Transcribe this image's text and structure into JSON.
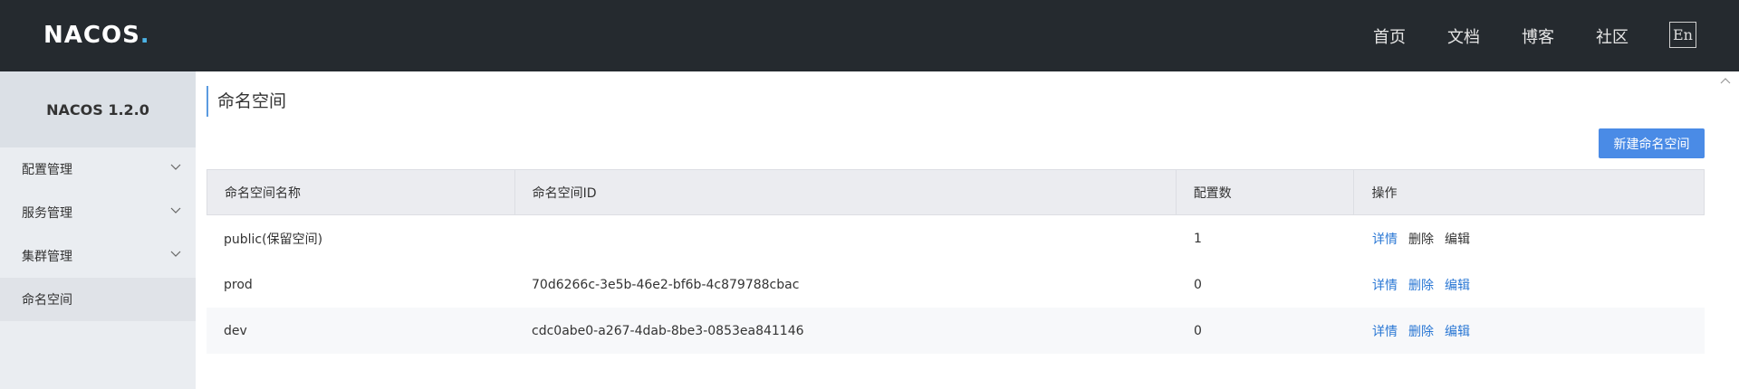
{
  "header": {
    "logo_text": "NACOS",
    "logo_dot": ".",
    "nav": [
      "首页",
      "文档",
      "博客",
      "社区"
    ],
    "lang_button": "En"
  },
  "sidebar": {
    "title": "NACOS 1.2.0",
    "items": [
      {
        "label": "配置管理",
        "expandable": true
      },
      {
        "label": "服务管理",
        "expandable": true
      },
      {
        "label": "集群管理",
        "expandable": true
      },
      {
        "label": "命名空间",
        "expandable": false,
        "active": true
      }
    ]
  },
  "main": {
    "title": "命名空间",
    "new_button": "新建命名空间",
    "columns": [
      "命名空间名称",
      "命名空间ID",
      "配置数",
      "操作"
    ],
    "rows": [
      {
        "name": "public(保留空间)",
        "id": "",
        "count": "1",
        "ops": [
          "详情",
          "删除",
          "编辑"
        ],
        "ops_enabled": [
          true,
          false,
          false
        ]
      },
      {
        "name": "prod",
        "id": "70d6266c-3e5b-46e2-bf6b-4c879788cbac",
        "count": "0",
        "ops": [
          "详情",
          "删除",
          "编辑"
        ],
        "ops_enabled": [
          true,
          true,
          true
        ]
      },
      {
        "name": "dev",
        "id": "cdc0abe0-a267-4dab-8be3-0853ea841146",
        "count": "0",
        "ops": [
          "详情",
          "删除",
          "编辑"
        ],
        "ops_enabled": [
          true,
          true,
          true
        ]
      }
    ]
  },
  "colors": {
    "topbar": "#252a2f",
    "accent": "#4a8be6",
    "link": "#2a77d4"
  }
}
